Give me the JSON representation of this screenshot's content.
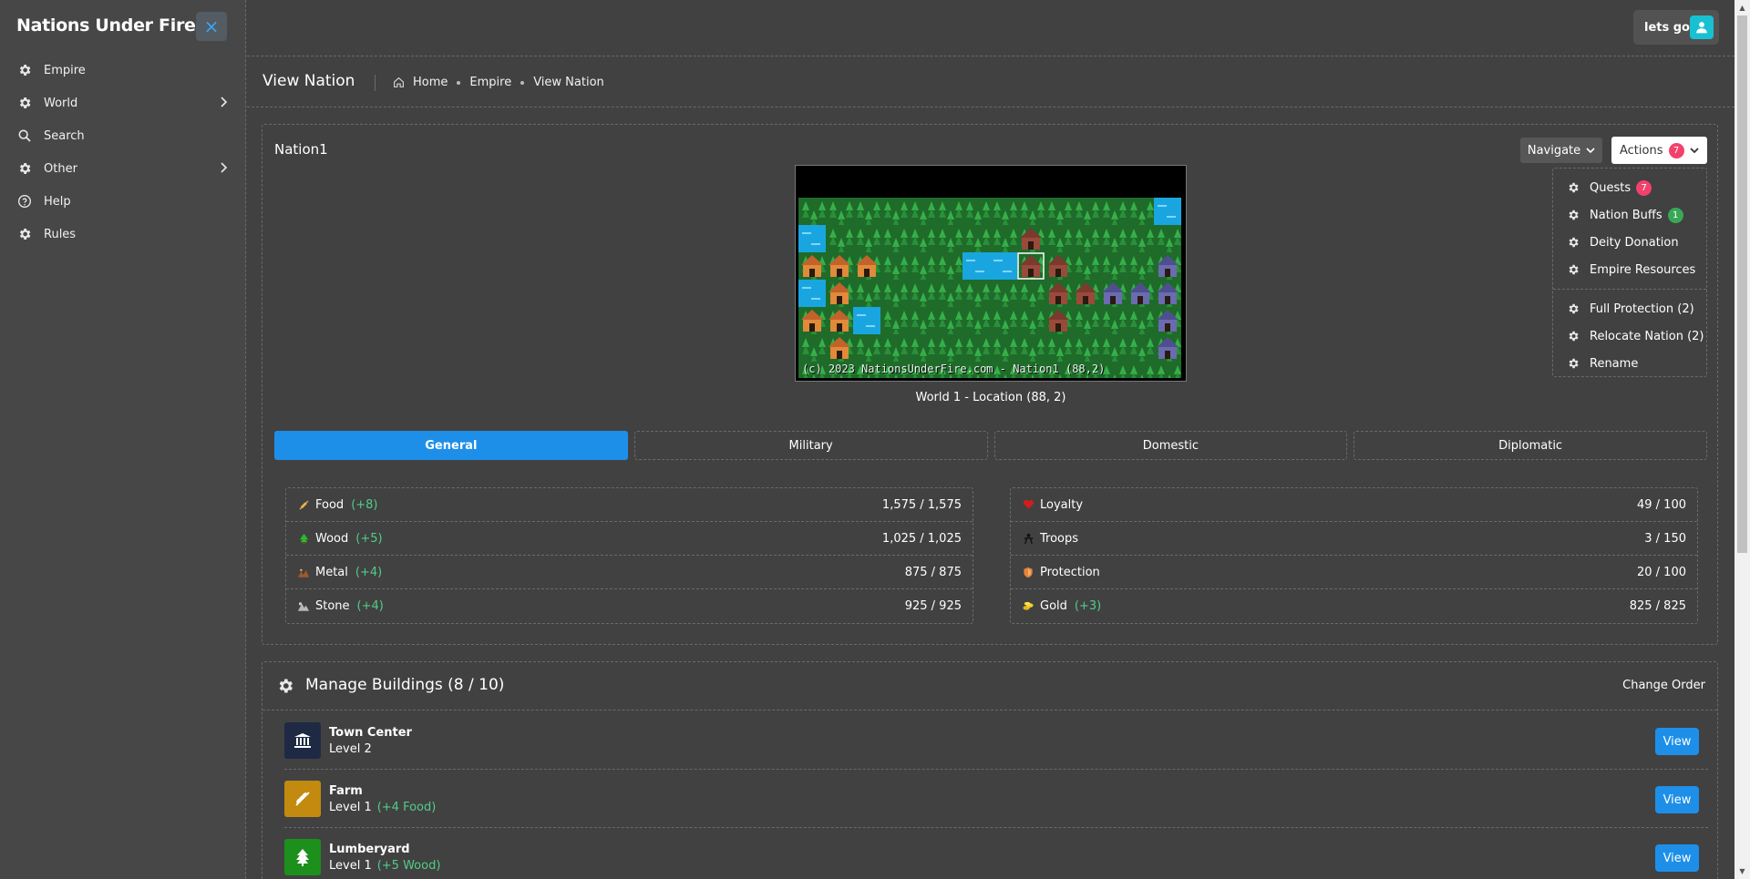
{
  "sidebar": {
    "brand": "Nations Under Fire",
    "close_icon": "×",
    "items": [
      {
        "label": "Empire",
        "icon": "gear-icon",
        "has_children": false
      },
      {
        "label": "World",
        "icon": "gear-icon",
        "has_children": true
      },
      {
        "label": "Search",
        "icon": "search-icon",
        "has_children": false
      },
      {
        "label": "Other",
        "icon": "gear-icon",
        "has_children": true
      },
      {
        "label": "Help",
        "icon": "help-icon",
        "has_children": false
      },
      {
        "label": "Rules",
        "icon": "gear-icon",
        "has_children": false
      }
    ]
  },
  "header": {
    "user_label": "lets go",
    "page_title": "View Nation",
    "breadcrumb": [
      "Home",
      "Empire",
      "View Nation"
    ]
  },
  "nation": {
    "name": "Nation1",
    "navigate_label": "Navigate",
    "actions_label": "Actions",
    "actions_badge": "7",
    "map_caption": "(c) 2023 NationsUnderFire.com - Nation1 (88,2)",
    "location": "World 1 - Location (88, 2)"
  },
  "actions_menu": {
    "group1": [
      {
        "label": "Quests",
        "badge": "7",
        "badge_color": "#f1416c"
      },
      {
        "label": "Nation Buffs",
        "badge": "1",
        "badge_color": "#39a856"
      },
      {
        "label": "Deity Donation",
        "badge": ""
      },
      {
        "label": "Empire Resources",
        "badge": ""
      }
    ],
    "group2": [
      {
        "label": "Full Protection (2)"
      },
      {
        "label": "Relocate Nation (2)"
      },
      {
        "label": "Rename"
      }
    ]
  },
  "tabs": [
    {
      "label": "General",
      "active": true
    },
    {
      "label": "Military",
      "active": false
    },
    {
      "label": "Domestic",
      "active": false
    },
    {
      "label": "Diplomatic",
      "active": false
    }
  ],
  "resources_left": [
    {
      "label": "Food",
      "delta": "(+8)",
      "value": "1,575 / 1,575",
      "icon": "food-icon"
    },
    {
      "label": "Wood",
      "delta": "(+5)",
      "value": "1,025 / 1,025",
      "icon": "wood-icon"
    },
    {
      "label": "Metal",
      "delta": "(+4)",
      "value": "875 / 875",
      "icon": "metal-icon"
    },
    {
      "label": "Stone",
      "delta": "(+4)",
      "value": "925 / 925",
      "icon": "stone-icon"
    }
  ],
  "resources_right": [
    {
      "label": "Loyalty",
      "delta": "",
      "value": "49 / 100",
      "icon": "heart-icon"
    },
    {
      "label": "Troops",
      "delta": "",
      "value": "3 / 150",
      "icon": "troops-icon"
    },
    {
      "label": "Protection",
      "delta": "",
      "value": "20 / 100",
      "icon": "shield-icon"
    },
    {
      "label": "Gold",
      "delta": "(+3)",
      "value": "825 / 825",
      "icon": "gold-icon"
    }
  ],
  "buildings": {
    "title": "Manage Buildings (8 / 10)",
    "change_order": "Change Order",
    "view_label": "View",
    "items": [
      {
        "name": "Town Center",
        "level": "Level 2",
        "delta": "",
        "color": "#1e2a44",
        "icon": "bank-icon"
      },
      {
        "name": "Farm",
        "level": "Level 1",
        "delta": "(+4 Food)",
        "color": "#c38a10",
        "icon": "wheat-icon"
      },
      {
        "name": "Lumberyard",
        "level": "Level 1",
        "delta": "(+5 Wood)",
        "color": "#1c8f1c",
        "icon": "tree-icon"
      }
    ]
  },
  "colors": {
    "accent": "#1e8fe8",
    "positive": "#50cd89",
    "badge_red": "#f1416c",
    "badge_green": "#39a856"
  }
}
